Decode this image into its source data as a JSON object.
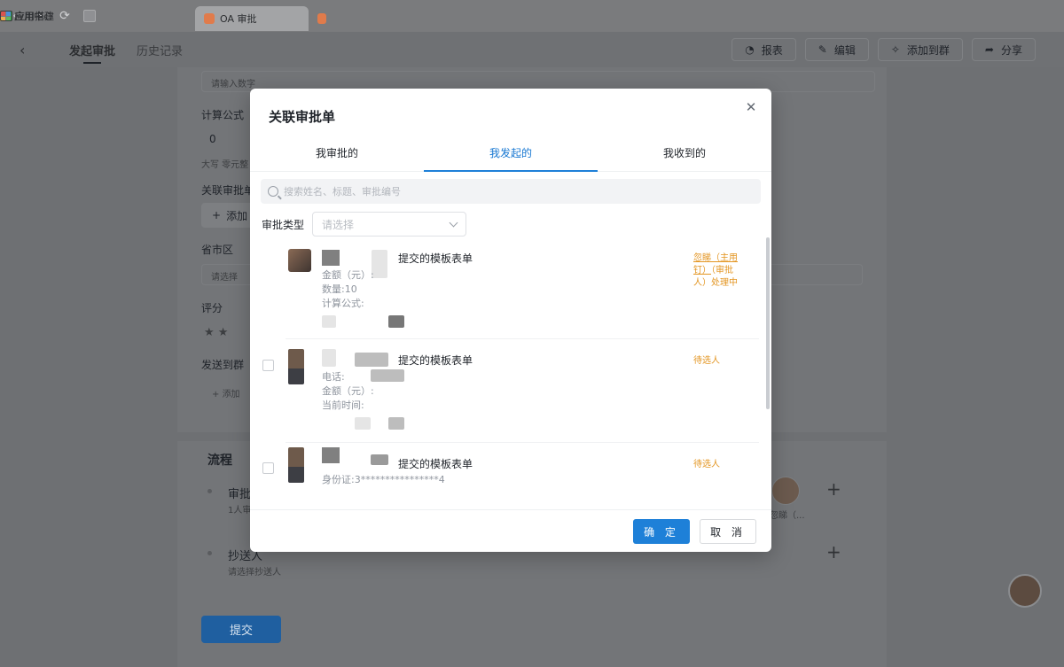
{
  "browser": {
    "active_tab": "OA 审批",
    "right_items": [
      "应用中心",
      "应用搭建"
    ]
  },
  "header": {
    "tabs": [
      "发起审批",
      "历史记录"
    ],
    "actions": [
      "报表",
      "编辑",
      "添加到群",
      "分享"
    ]
  },
  "form": {
    "placeholder_top": "请输入数字",
    "calc_label": "计算公式",
    "calc_value": "0",
    "uppercase_hint": "大写 零元整",
    "related_label": "关联审批单",
    "add_label": "添加",
    "province_label": "省市区",
    "province_placeholder": "请选择",
    "rating_label": "评分",
    "send_group_label": "发送到群",
    "send_group_add": "添加",
    "flow_title": "流程",
    "approver_label": "审批人",
    "approver_sub": "1人审批",
    "approver_name": "忽睇（...",
    "cc_label": "抄送人",
    "cc_sub": "请选择抄送人",
    "submit": "提交"
  },
  "modal": {
    "title": "关联审批单",
    "tabs": [
      "我审批的",
      "我发起的",
      "我收到的"
    ],
    "active_tab_index": 1,
    "search_placeholder": "搜索姓名、标题、审批编号",
    "type_label": "审批类型",
    "type_placeholder": "请选择",
    "items": [
      {
        "title": "提交的模板表单",
        "fields": [
          "金额（元）:",
          "数量:10",
          "计算公式:"
        ],
        "status_link": "忽睇（主用钉）",
        "status_rest": "（审批人）处理中"
      },
      {
        "title": "提交的模板表单",
        "fields": [
          "电话:",
          "金额（元）:",
          "当前时间:"
        ],
        "status_link": "",
        "status_rest": "待选人"
      },
      {
        "title": "提交的模板表单",
        "fields": [
          "身份证:3****************4"
        ],
        "status_link": "",
        "status_rest": "待选人"
      }
    ],
    "confirm": "确 定",
    "cancel": "取 消"
  },
  "colors": {
    "accent": "#1e80d8",
    "status_orange": "#e39521",
    "overlay": "#6e7073"
  }
}
